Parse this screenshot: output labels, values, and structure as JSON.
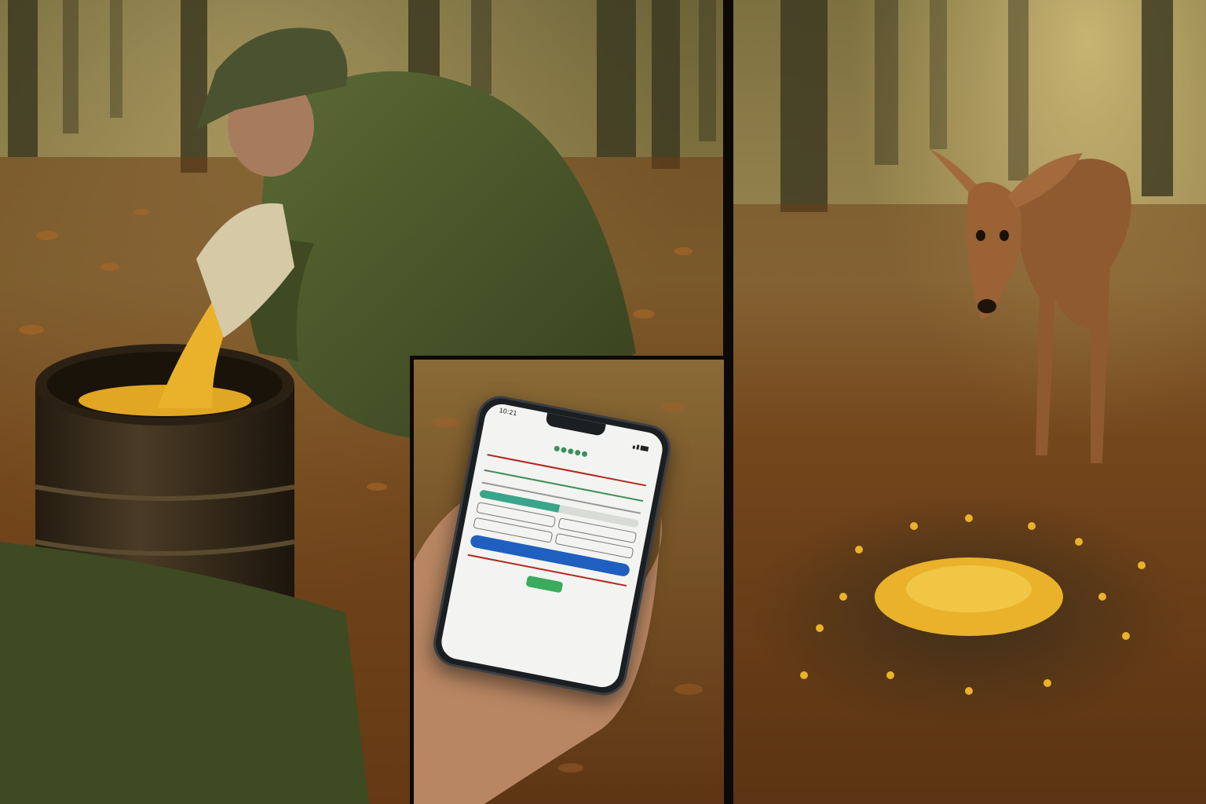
{
  "scene": {
    "panels": [
      {
        "name": "left",
        "description_icon": "person-pouring-corn-icon"
      },
      {
        "name": "inset",
        "description_icon": "phone-in-hand-icon"
      },
      {
        "name": "right",
        "description_icon": "deer-icon"
      }
    ],
    "colors": {
      "fog": "#8a7440",
      "leaves": "#9c5a1e",
      "corn": "#e9b22a",
      "jacket": "#4b5a2c",
      "barrel": "#3a2f1f",
      "deer": "#9a6235",
      "frame": "#0c0a07"
    }
  },
  "phone": {
    "status_time": "10:21",
    "app_title": "",
    "app_subtitle": "",
    "section_title": "",
    "accent_red": "#b3261e",
    "accent_green": "#3f8f5c",
    "accent_blue": "#1f5fbf",
    "primary_button": "",
    "confirm_button": "",
    "progress": 0.5
  }
}
